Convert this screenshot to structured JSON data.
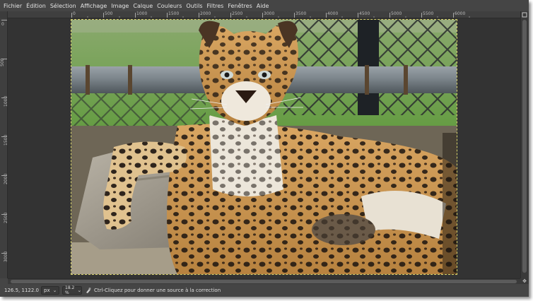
{
  "menubar": {
    "items": [
      "Fichier",
      "Édition",
      "Sélection",
      "Affichage",
      "Image",
      "Calque",
      "Couleurs",
      "Outils",
      "Filtres",
      "Fenêtres",
      "Aide"
    ]
  },
  "ruler_top": {
    "labels": [
      "0",
      "500",
      "1000",
      "1500",
      "2000",
      "2500",
      "3000",
      "3500",
      "4000",
      "4500",
      "5000",
      "5500",
      "6000"
    ]
  },
  "ruler_left": {
    "labels": [
      "0",
      "500",
      "1000",
      "1500",
      "2000",
      "2500",
      "3000"
    ]
  },
  "statusbar": {
    "coordinates": "126.5, 1122.0",
    "unit": "px",
    "zoom": "18.2 %",
    "message": "Ctrl-Cliquez pour donner une source à la correction"
  },
  "image": {
    "subject": "leopard-photo"
  },
  "colors": {
    "window_bg": "#454545",
    "canvas_bg": "#333333",
    "selection_outline": "#d6d16a"
  }
}
